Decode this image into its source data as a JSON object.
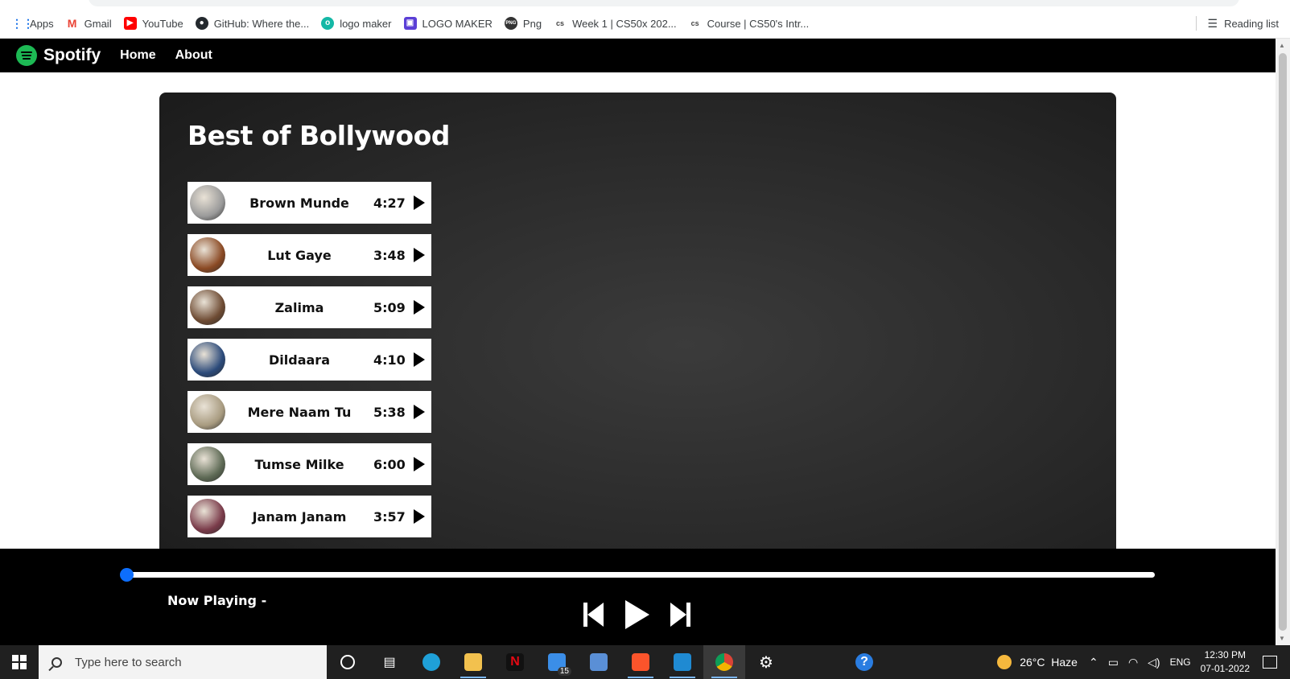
{
  "browser": {
    "bookmarks": [
      {
        "label": "Apps",
        "icon": "apps-grid-icon",
        "color": "#1a73e8"
      },
      {
        "label": "Gmail",
        "icon": "gmail-icon",
        "color": "#ea4335"
      },
      {
        "label": "YouTube",
        "icon": "youtube-icon",
        "color": "#ff0000"
      },
      {
        "label": "GitHub: Where the...",
        "icon": "github-icon",
        "color": "#24292e"
      },
      {
        "label": "logo maker",
        "icon": "logo-maker-icon",
        "color": "#14b8a6"
      },
      {
        "label": "LOGO MAKER",
        "icon": "logo-maker-square-icon",
        "color": "#5b3fd6"
      },
      {
        "label": "Png",
        "icon": "png-icon",
        "color": "#333333"
      },
      {
        "label": "Week 1 | CS50x 202...",
        "icon": "cs50-icon",
        "color": "#444444"
      },
      {
        "label": "Course | CS50's Intr...",
        "icon": "cs50-icon",
        "color": "#444444"
      }
    ],
    "reading_list": "Reading list"
  },
  "navbar": {
    "brand": "Spotify",
    "links": [
      "Home",
      "About"
    ]
  },
  "playlist": {
    "title": "Best of Bollywood",
    "songs": [
      {
        "name": "Brown Munde",
        "duration": "4:27",
        "cover_color": "#9a9a9a"
      },
      {
        "name": "Lut Gaye",
        "duration": "3:48",
        "cover_color": "#8b4a24"
      },
      {
        "name": "Zalima",
        "duration": "5:09",
        "cover_color": "#6e4b33"
      },
      {
        "name": "Dildaara",
        "duration": "4:10",
        "cover_color": "#2b4a7a"
      },
      {
        "name": "Mere Naam Tu",
        "duration": "5:38",
        "cover_color": "#a89b80"
      },
      {
        "name": "Tumse Milke",
        "duration": "6:00",
        "cover_color": "#5e6a55"
      },
      {
        "name": "Janam Janam",
        "duration": "3:57",
        "cover_color": "#7a3b4a"
      }
    ]
  },
  "player": {
    "now_playing": "Now Playing -",
    "progress": 0.0,
    "accent": "#0d6efd"
  },
  "taskbar": {
    "search_placeholder": "Type here to search",
    "mail_badge": "15",
    "weather": "26°C  Haze",
    "language": "ENG",
    "time": "12:30 PM",
    "date": "07-01-2022"
  },
  "colors": {
    "spotify_green": "#1db954",
    "navbar_bg": "#000000",
    "taskbar_bg": "#202020"
  }
}
